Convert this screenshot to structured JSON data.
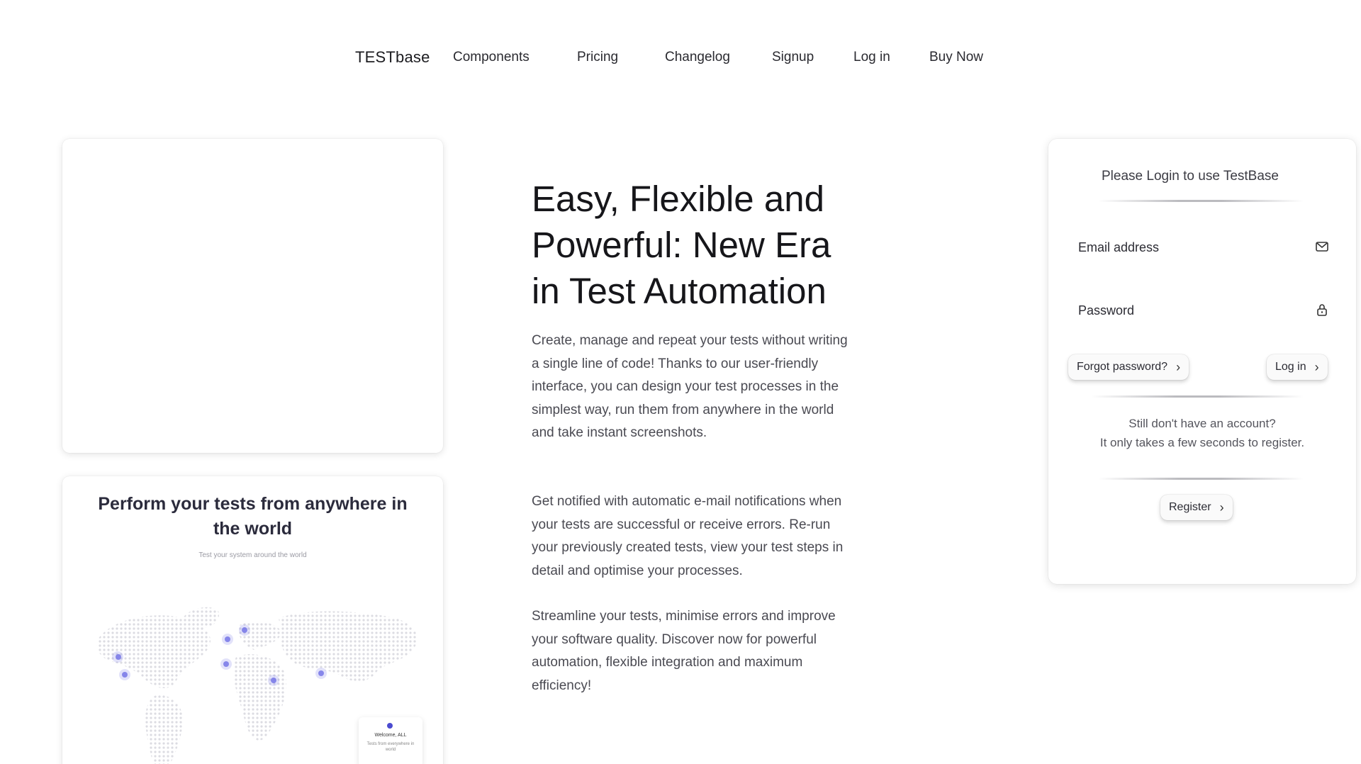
{
  "nav": {
    "brand": "TESTbase",
    "links": [
      "Components",
      "Pricing",
      "Changelog",
      "Signup",
      "Log in",
      "Buy Now"
    ]
  },
  "map_card": {
    "title": "Perform your tests from anywhere in the world",
    "subtitle": "Test your system around the world",
    "tooltip_title": "Welcome, ALL",
    "tooltip_text": "Tests from everywhere in world"
  },
  "hero": {
    "title": "Easy, Flexible and Powerful: New Era in Test Automation",
    "p1": "Create, manage and repeat your tests without writing a single line of code! Thanks to our user-friendly interface, you can design your test processes in the simplest way, run them from anywhere in the world and take instant screenshots.",
    "p2": "Get notified with automatic e-mail notifications when your tests are successful or receive errors. Re-run your previously created tests, view your test steps in detail and optimise your processes.",
    "p3": "Streamline your tests, minimise errors and improve your software quality. Discover now for powerful automation, flexible integration and maximum efficiency!"
  },
  "login": {
    "heading": "Please Login to use TestBase",
    "email_placeholder": "Email address",
    "password_placeholder": "Password",
    "forgot_label": "Forgot password?",
    "login_label": "Log in",
    "note_line1": "Still don't have an account?",
    "note_line2": "It only takes a few seconds to register.",
    "register_label": "Register",
    "icons": {
      "email": "mail-icon",
      "password": "lock-icon",
      "chevron": "chevron-right-icon"
    }
  },
  "colors": {
    "accent_dot": "#6b6be0",
    "map_dots": "#d9d9df"
  }
}
